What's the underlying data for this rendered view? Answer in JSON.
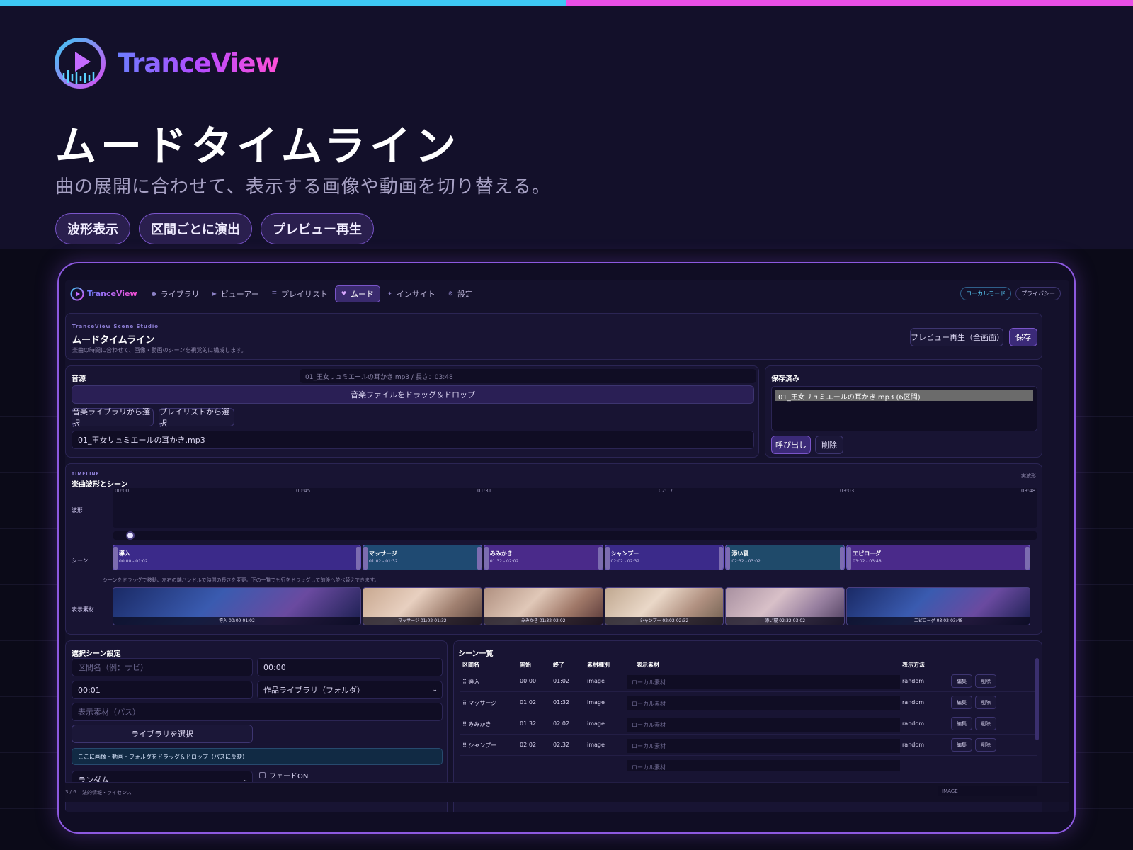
{
  "brand": "TranceView",
  "hero": {
    "title": "ムードタイムライン",
    "subtitle": "曲の展開に合わせて、表示する画像や動画を切り替える。",
    "pills": [
      "波形表示",
      "区間ごとに演出",
      "プレビュー再生"
    ]
  },
  "colors": {
    "accent": "#8d59e0",
    "cyan": "#3ec8f5",
    "pink": "#e94fe6",
    "waveform_start": "#8a7bff",
    "waveform_mid": "#b96cff"
  },
  "nav": {
    "logo": "TranceView",
    "items": [
      {
        "label": "ライブラリ",
        "icon": "library-icon"
      },
      {
        "label": "ビューアー",
        "icon": "play-icon"
      },
      {
        "label": "プレイリスト",
        "icon": "list-icon"
      },
      {
        "label": "ムード",
        "icon": "heart-icon"
      },
      {
        "label": "インサイト",
        "icon": "sparkle-icon"
      },
      {
        "label": "設定",
        "icon": "gear-icon"
      }
    ],
    "active": "ムード",
    "local_mode": "ローカルモード",
    "privacy": "プライバシー"
  },
  "studio": {
    "eyebrow": "TranceView Scene Studio",
    "title": "ムードタイムライン",
    "description": "楽曲の時間に合わせて、画像・動画のシーンを視覚的に構成します。",
    "preview_button": "プレビュー再生（全画面）",
    "save_button": "保存"
  },
  "source": {
    "label": "音源",
    "info": "01_王女リュミエールの耳かき.mp3 / 長さ：03:48",
    "dropzone": "音楽ファイルをドラッグ＆ドロップ",
    "from_library": "音楽ライブラリから選択",
    "from_playlist": "プレイリストから選択",
    "file_value": "01_王女リュミエールの耳かき.mp3"
  },
  "saved": {
    "label": "保存済み",
    "selected": "01_王女リュミエールの耳かき.mp3 (6区間)",
    "load": "呼び出し",
    "delete": "削除"
  },
  "timeline": {
    "eyebrow": "TIMELINE",
    "title": "楽曲波形とシーン",
    "mode": "実波形",
    "ticks": [
      "00:00",
      "00:45",
      "01:31",
      "02:17",
      "03:03",
      "03:48"
    ],
    "row_waveform": "波形",
    "row_scene": "シーン",
    "row_media": "表示素材",
    "hint": "シーンをドラッグで移動、左右の端ハンドルで時間の長さを変更。下の一覧でも行をドラッグして前後へ並べ替えできます。",
    "playhead": 0.01,
    "scenes": [
      {
        "name": "導入",
        "range": "00:00 - 01:02",
        "start": 0,
        "end": 62
      },
      {
        "name": "マッサージ",
        "range": "01:02 - 01:32",
        "start": 62,
        "end": 92
      },
      {
        "name": "みみかき",
        "range": "01:32 - 02:02",
        "start": 92,
        "end": 122
      },
      {
        "name": "シャンプー",
        "range": "02:02 - 02:32",
        "start": 122,
        "end": 152
      },
      {
        "name": "添い寝",
        "range": "02:32 - 03:02",
        "start": 152,
        "end": 182
      },
      {
        "name": "エピローグ",
        "range": "03:02 - 03:48",
        "start": 182,
        "end": 228
      }
    ],
    "media": [
      "導入 00:00-01:02",
      "マッサージ 01:02-01:32",
      "みみかき 01:32-02:02",
      "シャンプー 02:02-02:32",
      "添い寝 02:32-03:02",
      "エピローグ 03:02-03:48"
    ],
    "duration": 228
  },
  "scene_settings": {
    "title": "選択シーン設定",
    "name_placeholder": "区間名（例：サビ）",
    "start_value": "00:00",
    "end_value": "00:01",
    "source_type": "作品ライブラリ（フォルダ）",
    "path_placeholder": "表示素材（パス）",
    "select_library": "ライブラリを選択",
    "drop_hint": "ここに画像・動画・フォルダをドラッグ＆ドロップ（パスに反映）",
    "mode_value": "ランダム",
    "fade_label": "フェードON"
  },
  "scene_list": {
    "title": "シーン一覧",
    "headers": [
      "区間名",
      "開始",
      "終了",
      "素材種別",
      "表示素材",
      "表示方法"
    ],
    "rows": [
      {
        "name": "⠿ 導入",
        "start": "00:00",
        "end": "01:02",
        "type": "image",
        "source": "ローカル素材",
        "method": "random"
      },
      {
        "name": "⠿ マッサージ",
        "start": "01:02",
        "end": "01:32",
        "type": "image",
        "source": "ローカル素材",
        "method": "random"
      },
      {
        "name": "⠿ みみかき",
        "start": "01:32",
        "end": "02:02",
        "type": "image",
        "source": "ローカル素材",
        "method": "random"
      },
      {
        "name": "⠿ シャンプー",
        "start": "02:02",
        "end": "02:32",
        "type": "image",
        "source": "ローカル素材",
        "method": "random"
      },
      {
        "name": "",
        "start": "",
        "end": "",
        "type": "",
        "source": "ローカル素材",
        "method": ""
      }
    ],
    "edit": "編集",
    "delete": "削除"
  },
  "footer": {
    "page": "3 / 6",
    "legal": "法的情報・ライセンス",
    "image_label": "IMAGE"
  }
}
